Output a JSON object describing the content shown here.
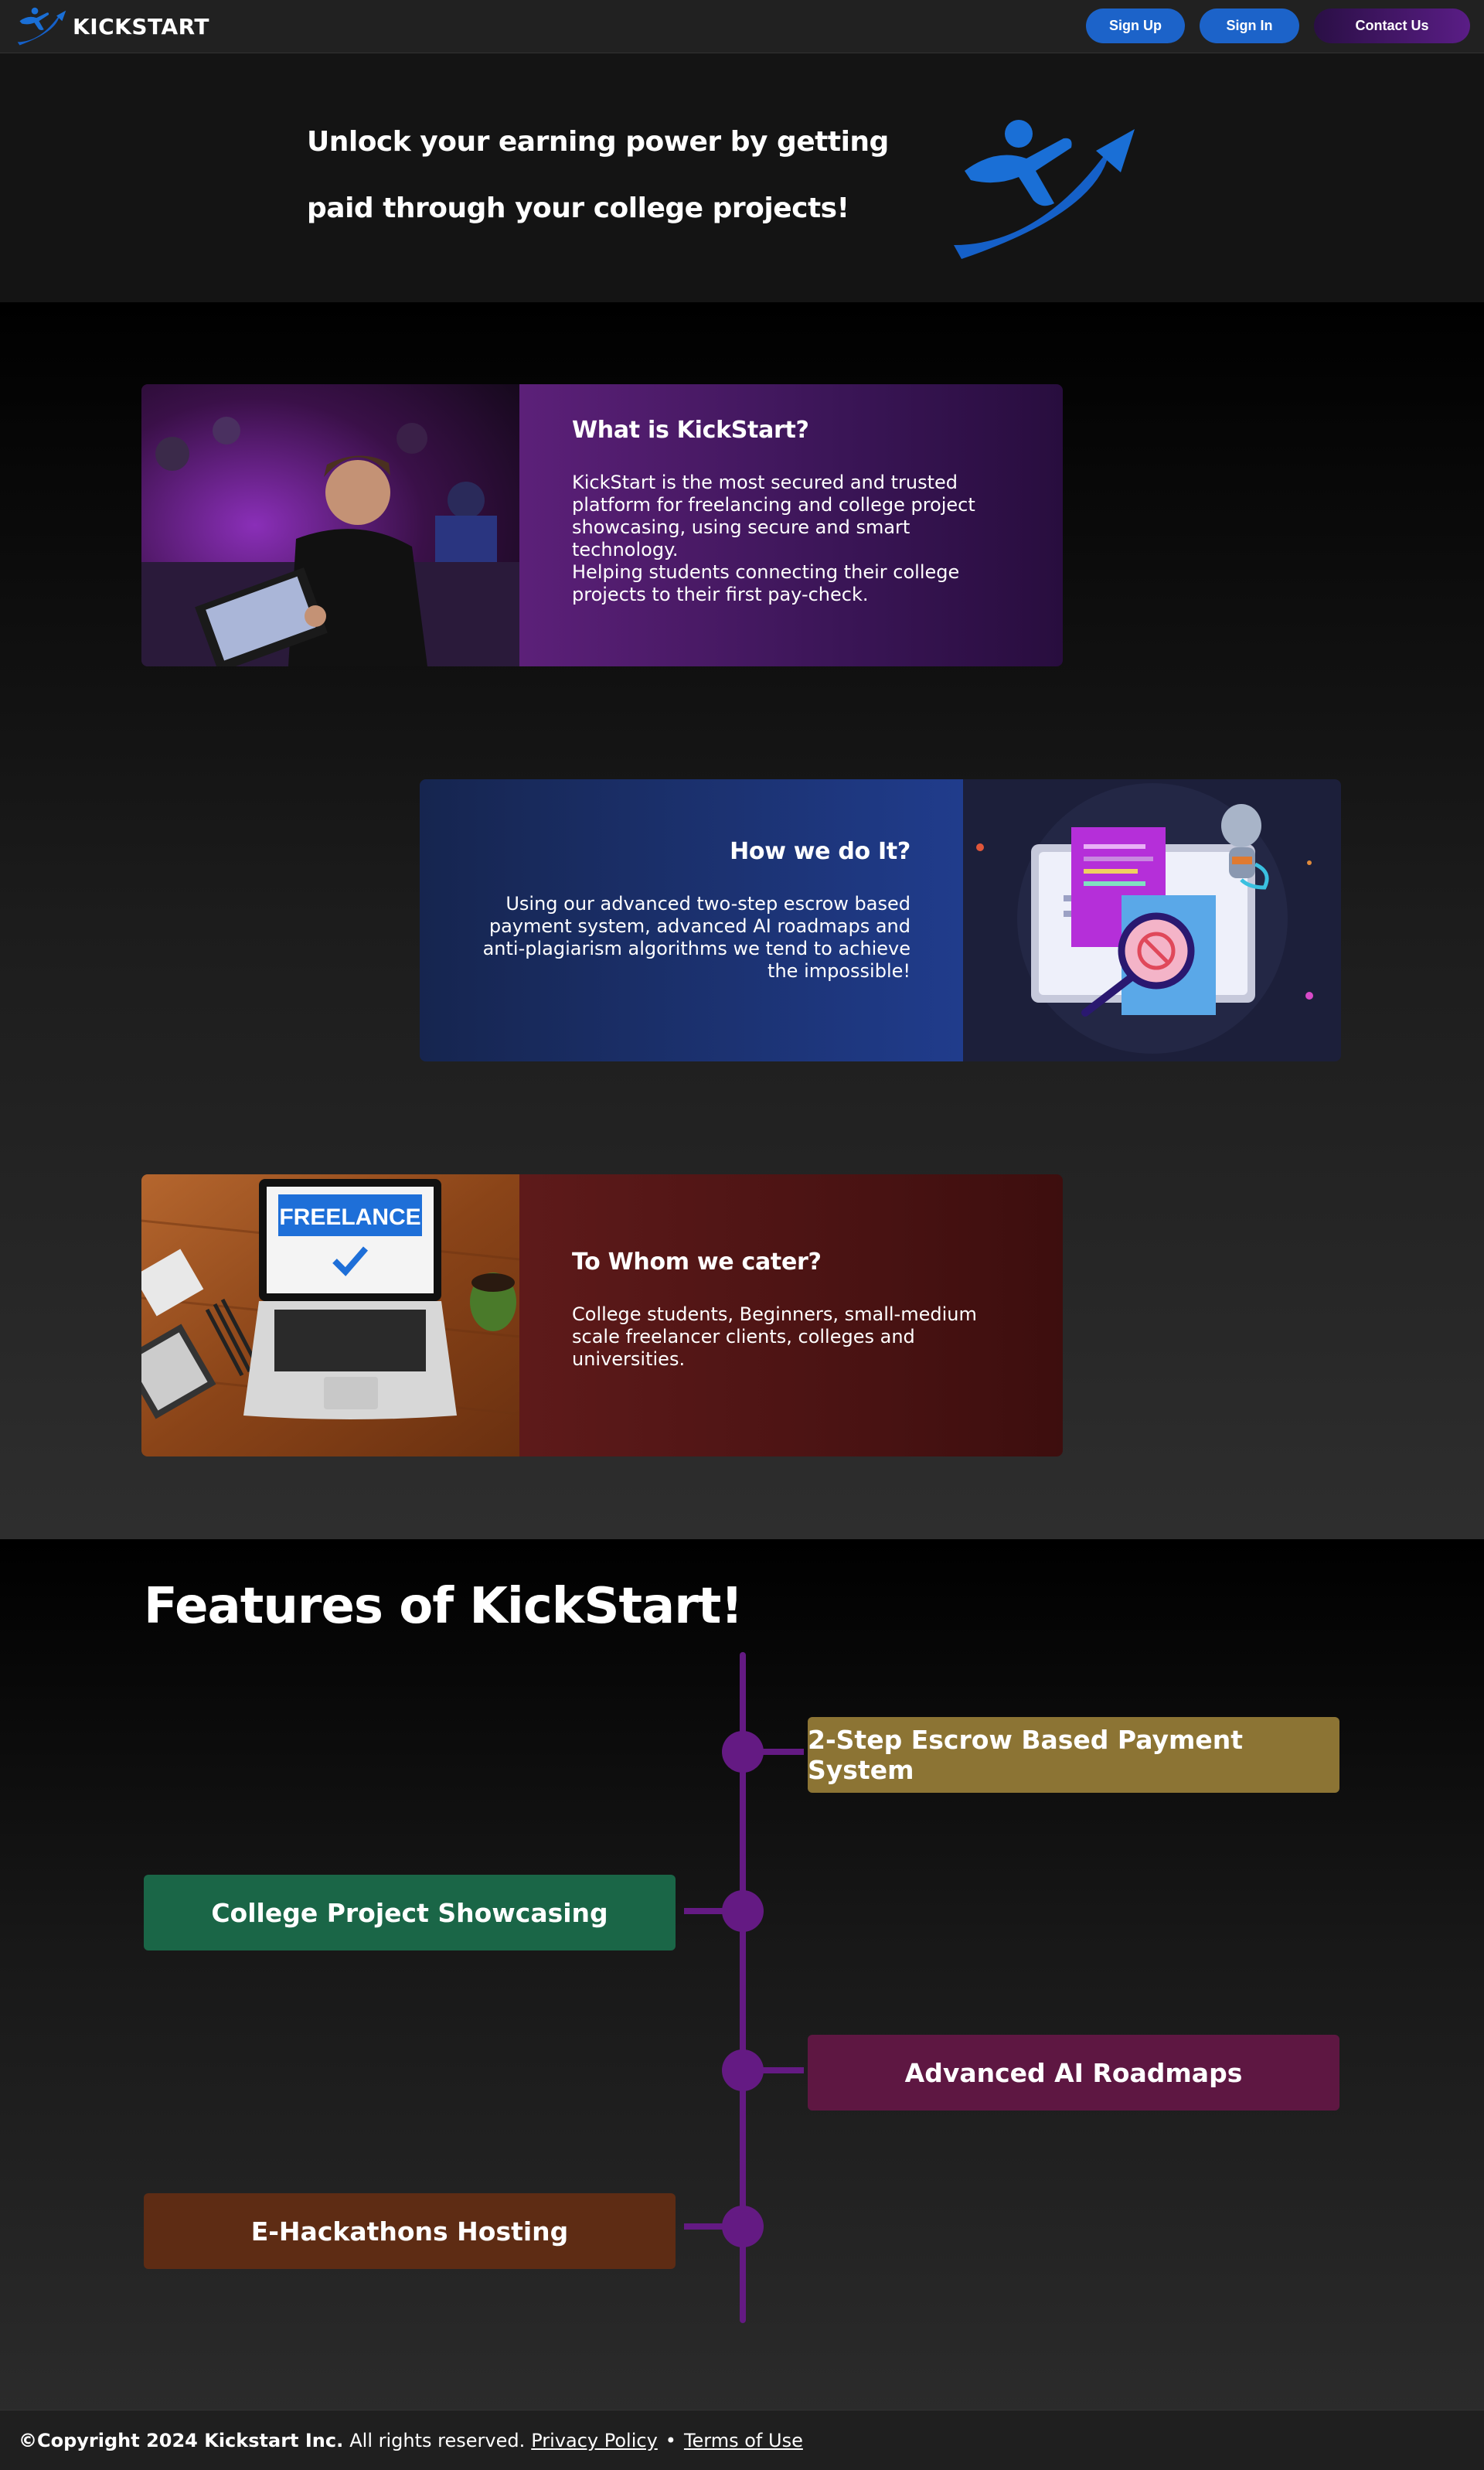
{
  "brand": {
    "name": "KICKSTART",
    "logo_icon": "kickstart-runner-icon"
  },
  "nav": {
    "signup_label": "Sign Up",
    "signin_label": "Sign In",
    "contact_label": "Contact Us"
  },
  "hero": {
    "line1": "Unlock your earning power by getting",
    "line2": "paid through your college projects!"
  },
  "cards": [
    {
      "title": "What is KickStart?",
      "text": "KickStart is the most secured and trusted platform for freelancing and college project showcasing, using secure and smart technology.",
      "text2": "Helping students connecting their college projects to their first pay-check.",
      "image": "hackathon-photo"
    },
    {
      "title": "How we do It?",
      "text": "Using our advanced two-step escrow based payment system, advanced AI roadmaps and anti-plagiarism algorithms we tend to achieve the impossible!",
      "image": "anti-plagiarism-illustration"
    },
    {
      "title": "To Whom we cater?",
      "text": "College students, Beginners, small-medium scale freelancer clients, colleges and universities.",
      "image": "freelance-laptop-photo",
      "image_text": "FREELANCE"
    }
  ],
  "features": {
    "title": "Features of KickStart!",
    "items": [
      {
        "label": "2-Step Escrow Based Payment System",
        "color": "#8c7434"
      },
      {
        "label": "College Project Showcasing",
        "color": "#1a6647"
      },
      {
        "label": "Advanced AI Roadmaps",
        "color": "#5e1742"
      },
      {
        "label": "E-Hackathons Hosting",
        "color": "#5e2c14"
      }
    ]
  },
  "footer": {
    "copyright": "©Copyright 2024 Kickstart Inc.",
    "rights": "All rights reserved.",
    "privacy": "Privacy Policy",
    "separator": "•",
    "terms": "Terms of Use"
  },
  "colors": {
    "accent_blue": "#1c63c9",
    "accent_purple": "#641a83"
  }
}
